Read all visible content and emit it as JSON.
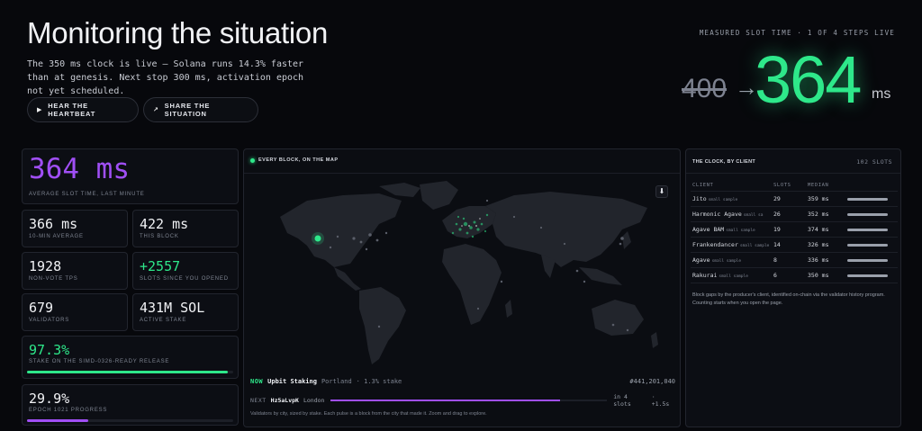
{
  "header": {
    "title": "Monitoring the situation",
    "subtitle": "The 350 ms clock is live — Solana runs 14.3% faster than at genesis. Next stop 300 ms, activation epoch not yet scheduled.",
    "buttons": [
      {
        "label": "HEAR THE HEARTBEAT",
        "icon": "play-icon"
      },
      {
        "label": "SHARE THE SITUATION",
        "icon": "arrow-up-right-icon"
      }
    ]
  },
  "slot_time": {
    "label": "MEASURED SLOT TIME · 1 OF 4 STEPS LIVE",
    "old": "400",
    "arrow": "→",
    "new": "364",
    "unit": "ms"
  },
  "stats": {
    "average": {
      "value": "364 ms",
      "label": "AVERAGE SLOT TIME, LAST MINUTE"
    },
    "min10": {
      "value": "366 ms",
      "label": "10-MIN AVERAGE"
    },
    "this_block": {
      "value": "422 ms",
      "label": "THIS BLOCK"
    },
    "tps": {
      "value": "1928",
      "label": "NON-VOTE TPS"
    },
    "slots_since": {
      "value": "+2557",
      "label": "SLOTS SINCE YOU OPENED"
    },
    "validators": {
      "value": "679",
      "label": "VALIDATORS"
    },
    "active_stake": {
      "value": "431M SOL",
      "label": "ACTIVE STAKE"
    },
    "ready": {
      "value": "97.3%",
      "label": "STAKE ON THE SIMD-0326-READY RELEASE",
      "fraction": 0.973
    },
    "epoch": {
      "value": "29.9%",
      "label": "EPOCH 1021 PROGRESS",
      "fraction": 0.299
    }
  },
  "map": {
    "title": "EVERY BLOCK, ON THE MAP",
    "download_icon": "download-icon",
    "now": {
      "tag": "NOW",
      "name": "Upbit Staking",
      "city": "Portland",
      "stake": "· 1.3% stake",
      "slot": "#441,201,040"
    },
    "next": {
      "tag": "NEXT",
      "name": "Hz5aLvpK",
      "city": "London",
      "eta": "in 4 slots",
      "delta": "· +1.5s",
      "fraction": 0.83
    },
    "footer": "Validators by city, sized by stake. Each pulse is a block from the city that made it. Zoom and drag to explore."
  },
  "clients": {
    "title": "THE CLOCK, BY CLIENT",
    "count": "102 SLOTS",
    "columns": [
      "CLIENT",
      "SLOTS",
      "MEDIAN"
    ],
    "rows": [
      {
        "name": "Jito",
        "note": "small sample",
        "slots": "29",
        "median": "359 ms"
      },
      {
        "name": "Harmonic Agave",
        "note": "small sa",
        "slots": "26",
        "median": "352 ms"
      },
      {
        "name": "Agave BAM",
        "note": "small sample",
        "slots": "19",
        "median": "374 ms"
      },
      {
        "name": "Frankendancer",
        "note": "small sample",
        "slots": "14",
        "median": "326 ms"
      },
      {
        "name": "Agave",
        "note": "small sample",
        "slots": "8",
        "median": "336 ms"
      },
      {
        "name": "Rakurai",
        "note": "small sample",
        "slots": "6",
        "median": "350 ms"
      }
    ],
    "note": "Block gaps by the producer's client, identified on-chain via the validator history program. Counting starts when you open the page."
  },
  "colors": {
    "accent_green": "#2ee88a",
    "accent_purple": "#a04ff5",
    "background": "#07080c"
  }
}
